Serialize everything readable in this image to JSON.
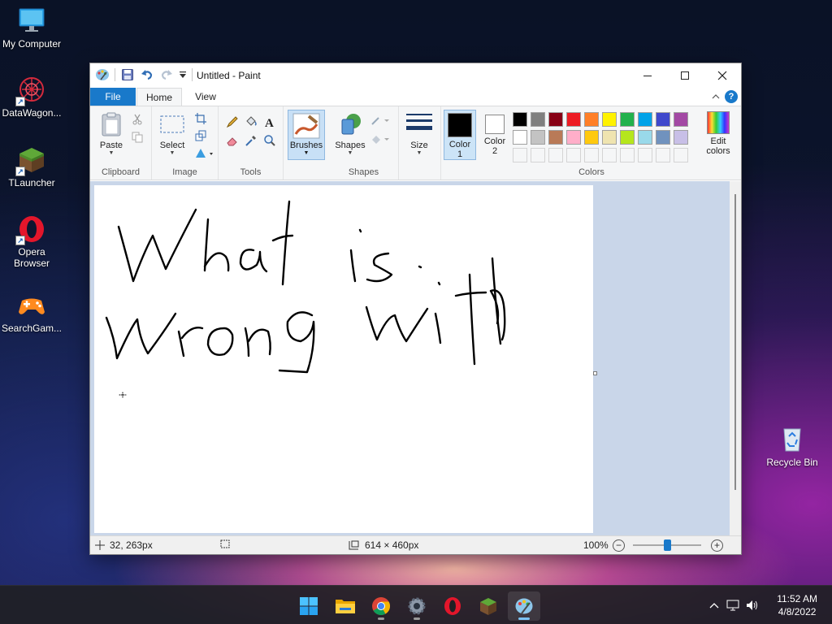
{
  "desktop": {
    "icons": [
      {
        "label": "My Computer",
        "icon": "monitor-icon"
      },
      {
        "label": "DataWagon...",
        "icon": "datawagon-icon"
      },
      {
        "label": "TLauncher",
        "icon": "grass-block-icon"
      },
      {
        "label": "Opera Browser",
        "icon": "opera-icon"
      },
      {
        "label": "SearchGam...",
        "icon": "gamepad-icon"
      },
      {
        "label": "Recycle Bin",
        "icon": "recycle-bin-icon"
      }
    ]
  },
  "window": {
    "title": "Untitled - Paint",
    "tabs": {
      "file": "File",
      "home": "Home",
      "view": "View"
    },
    "help": "?",
    "ribbon": {
      "clipboard": {
        "label": "Clipboard",
        "paste": "Paste"
      },
      "image": {
        "label": "Image",
        "select": "Select"
      },
      "tools": {
        "label": "Tools"
      },
      "brushes": {
        "label": "Brushes"
      },
      "shapes": {
        "label": "Shapes",
        "button": "Shapes"
      },
      "size": {
        "label": "Size"
      },
      "colors": {
        "label": "Colors",
        "color1_line1": "Color",
        "color1_line2": "1",
        "color2_line1": "Color",
        "color2_line2": "2",
        "edit_line1": "Edit",
        "edit_line2": "colors",
        "color1_value": "#000000",
        "color2_value": "#ffffff",
        "palette_row1": [
          "#000000",
          "#7f7f7f",
          "#880015",
          "#ed1c24",
          "#ff7f27",
          "#fff200",
          "#22b14c",
          "#00a2e8",
          "#3f48cc",
          "#a349a4"
        ],
        "palette_row2": [
          "#ffffff",
          "#c3c3c3",
          "#b97a57",
          "#ffaec9",
          "#ffc90e",
          "#efe4b0",
          "#b5e61d",
          "#99d9ea",
          "#7092be",
          "#c8bfe7"
        ]
      }
    },
    "canvas": {
      "handwriting": "What is wrong with"
    },
    "status": {
      "cursor_pos": "32, 263px",
      "canvas_size": "614 × 460px",
      "zoom": "100%"
    }
  },
  "taskbar": {
    "time": "11:52 AM",
    "date": "4/8/2022",
    "apps": [
      "start-icon",
      "file-explorer-icon",
      "chrome-icon",
      "settings-icon",
      "opera-icon",
      "minecraft-icon",
      "paint-icon"
    ]
  }
}
